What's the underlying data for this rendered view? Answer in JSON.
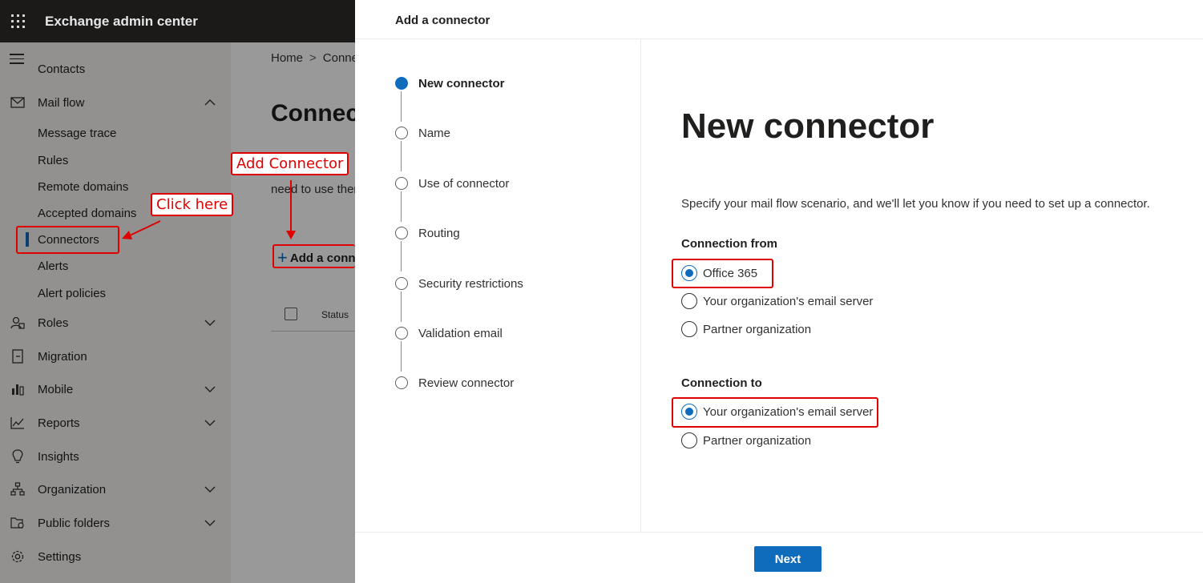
{
  "app": {
    "title": "Exchange admin center"
  },
  "sidebar": {
    "items": [
      {
        "label": "Contacts",
        "icon": "none"
      },
      {
        "label": "Mail flow",
        "icon": "mail-icon",
        "expanded": true
      },
      {
        "label": "Message trace"
      },
      {
        "label": "Rules"
      },
      {
        "label": "Remote domains"
      },
      {
        "label": "Accepted domains"
      },
      {
        "label": "Connectors",
        "active": true
      },
      {
        "label": "Alerts"
      },
      {
        "label": "Alert policies"
      },
      {
        "label": "Roles",
        "icon": "roles-icon"
      },
      {
        "label": "Migration",
        "icon": "migration-icon"
      },
      {
        "label": "Mobile",
        "icon": "mobile-icon"
      },
      {
        "label": "Reports",
        "icon": "reports-icon"
      },
      {
        "label": "Insights",
        "icon": "lightbulb-icon"
      },
      {
        "label": "Organization",
        "icon": "organization-icon"
      },
      {
        "label": "Public folders",
        "icon": "public-folders-icon"
      },
      {
        "label": "Settings",
        "icon": "gear-icon"
      }
    ]
  },
  "main": {
    "breadcrumb": {
      "home": "Home",
      "current": "Conne"
    },
    "title": "Connect",
    "description": "need to use ther",
    "add_button": "Add a conn",
    "table": {
      "status_header": "Status"
    }
  },
  "annotations": {
    "add_connector": "Add Connector",
    "click_here": "Click here",
    "accent": "#e00000"
  },
  "panel": {
    "header_title": "Add a connector",
    "steps": [
      {
        "label": "New connector",
        "current": true
      },
      {
        "label": "Name"
      },
      {
        "label": "Use of connector"
      },
      {
        "label": "Routing"
      },
      {
        "label": "Security restrictions"
      },
      {
        "label": "Validation email"
      },
      {
        "label": "Review connector"
      }
    ],
    "title": "New connector",
    "description": "Specify your mail flow scenario, and we'll let you know if you need to set up a connector.",
    "connection_from": {
      "title": "Connection from",
      "options": [
        "Office 365",
        "Your organization's email server",
        "Partner organization"
      ],
      "selected": "Office 365"
    },
    "connection_to": {
      "title": "Connection to",
      "options": [
        "Your organization's email server",
        "Partner organization"
      ],
      "selected": "Your organization's email server"
    },
    "next_button": "Next",
    "accent": "#0f6cbd"
  }
}
